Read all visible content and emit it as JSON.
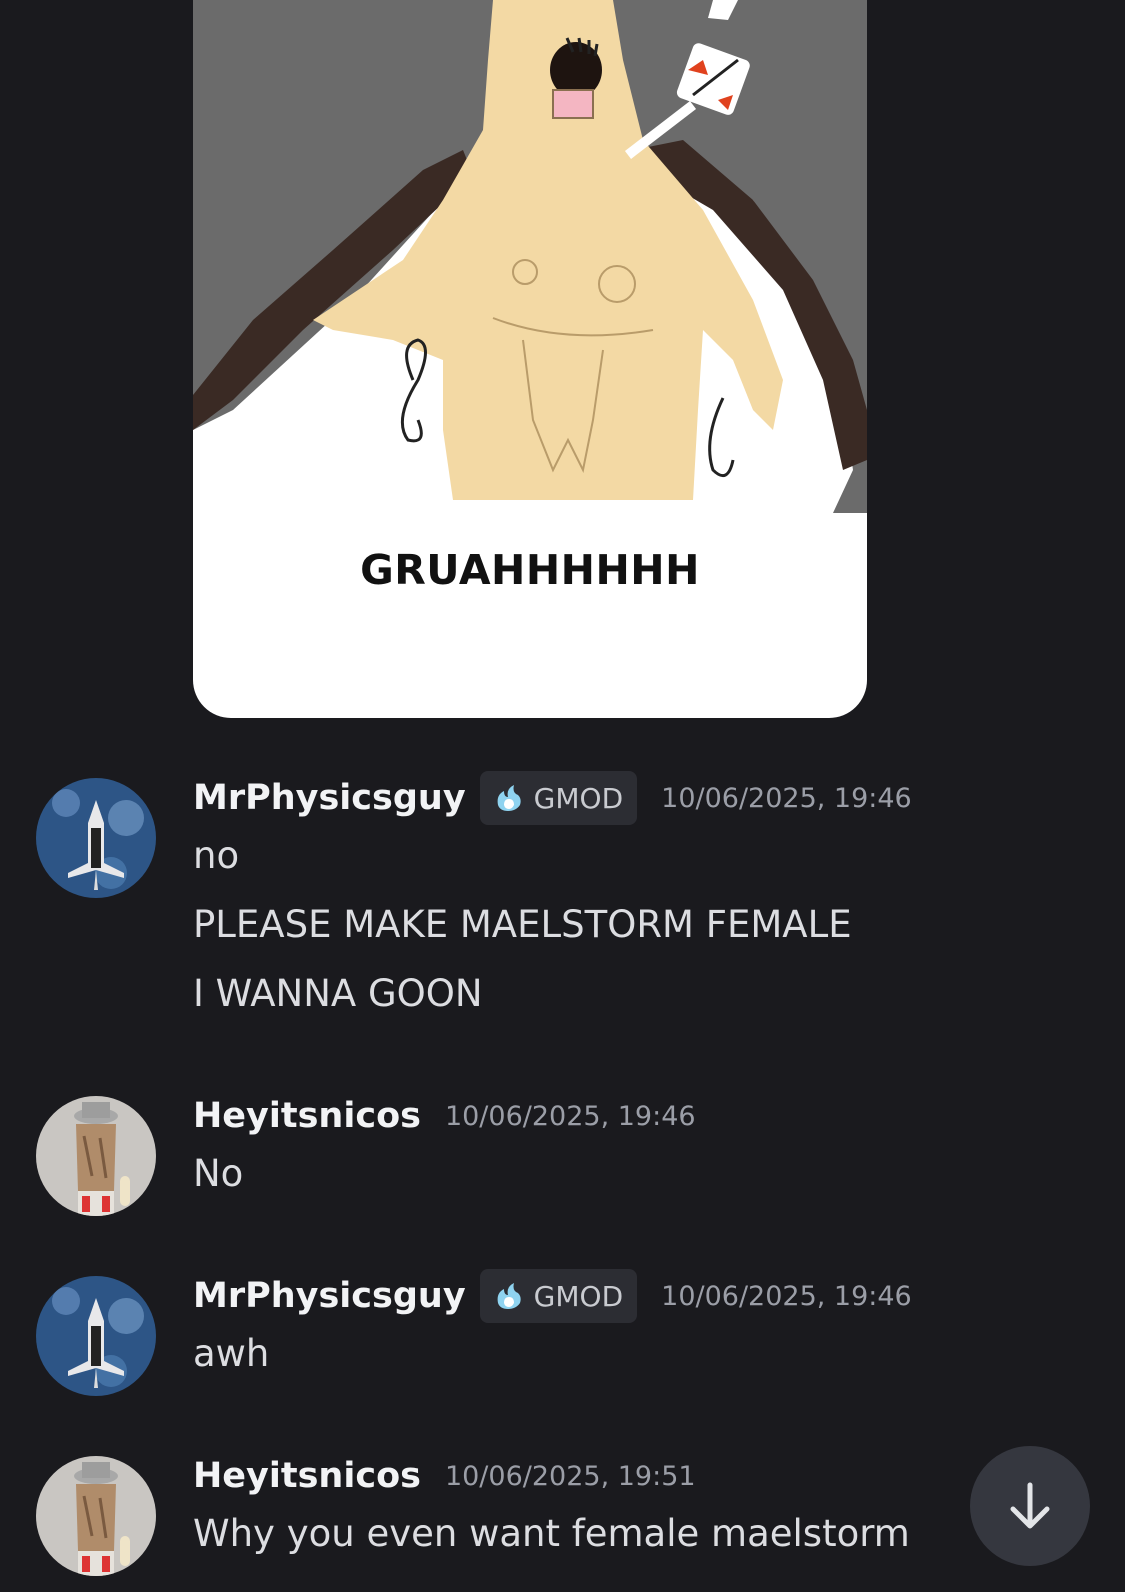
{
  "attachment": {
    "caption": "GRUAHHHHHH"
  },
  "messages": [
    {
      "author": "MrPhysicsguy",
      "tag": "GMOD",
      "tag_icon": "flame-badge-icon",
      "timestamp": "10/06/2025, 19:46",
      "avatar": "space-shuttle-avatar",
      "lines": [
        "no",
        "PLEASE MAKE MAELSTORM FEMALE",
        "I WANNA GOON"
      ]
    },
    {
      "author": "Heyitsnicos",
      "timestamp": "10/06/2025, 19:46",
      "avatar": "figure-with-hat-avatar",
      "lines": [
        "No"
      ]
    },
    {
      "author": "MrPhysicsguy",
      "tag": "GMOD",
      "tag_icon": "flame-badge-icon",
      "timestamp": "10/06/2025, 19:46",
      "avatar": "space-shuttle-avatar",
      "lines": [
        "awh"
      ]
    },
    {
      "author": "Heyitsnicos",
      "timestamp": "10/06/2025, 19:51",
      "avatar": "figure-with-hat-avatar",
      "lines": [
        "Why you even want female maelstorm"
      ]
    }
  ],
  "jump_button": {
    "icon": "arrow-down-icon"
  },
  "colors": {
    "background": "#1a1a1e",
    "tag_background": "#2c2d33",
    "timestamp": "#9b9ea7",
    "jump_button": "#35373f"
  }
}
